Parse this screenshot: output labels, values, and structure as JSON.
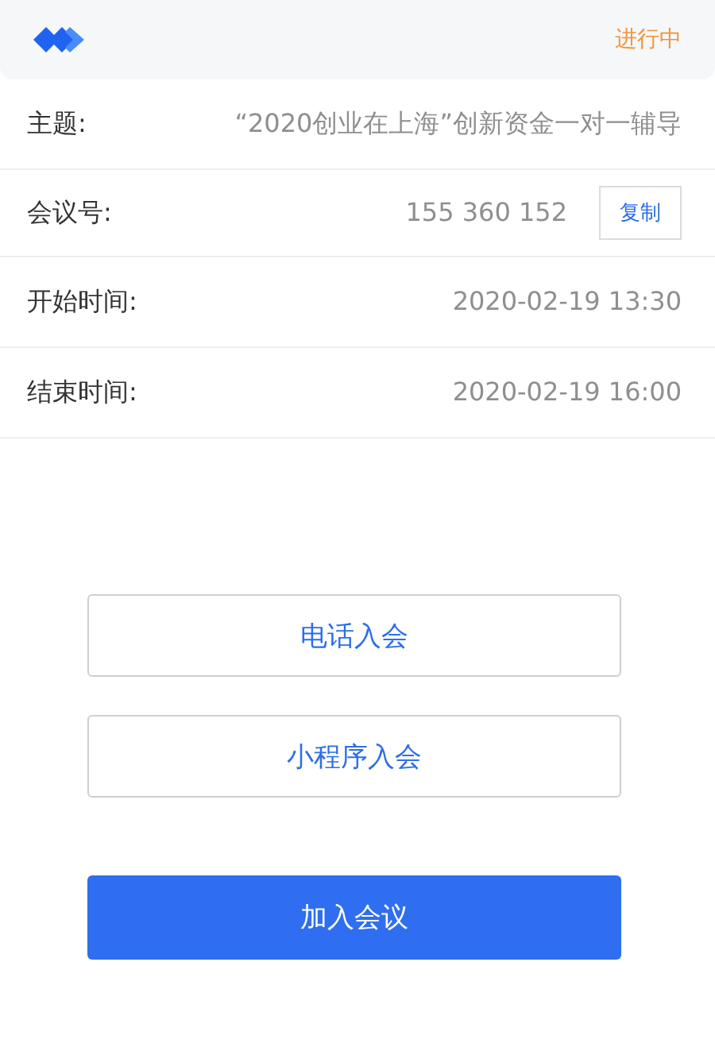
{
  "header": {
    "status": "进行中"
  },
  "details": [
    {
      "label": "主题:",
      "value": "“2020创业在上海”创新资金一对一辅导"
    },
    {
      "label": "会议号:",
      "value": "155 360 152",
      "action": "复制"
    },
    {
      "label": "开始时间:",
      "value": "2020-02-19 13:30"
    },
    {
      "label": "结束时间:",
      "value": "2020-02-19 16:00"
    }
  ],
  "buttons": [
    {
      "label": "电话入会",
      "kind": "outline"
    },
    {
      "label": "小程序入会",
      "kind": "outline"
    },
    {
      "label": "加入会议",
      "kind": "primary"
    }
  ]
}
